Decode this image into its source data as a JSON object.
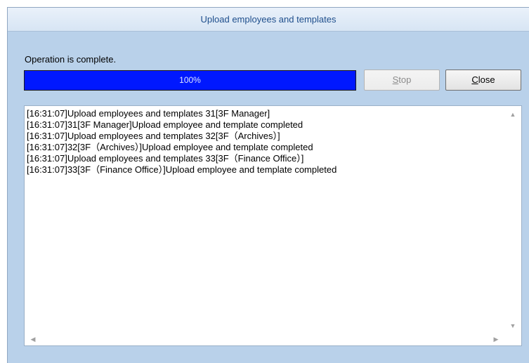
{
  "window": {
    "title": "Upload employees and templates"
  },
  "status": {
    "text": "Operation is complete."
  },
  "progress": {
    "value": 100,
    "label": "100%"
  },
  "buttons": {
    "stop_mnemonic": "S",
    "stop_rest": "top",
    "close_mnemonic": "C",
    "close_rest": "lose"
  },
  "log": {
    "lines": [
      "[16:31:07]Upload employees and templates 31[3F Manager]",
      "[16:31:07]31[3F Manager]Upload employee and template completed",
      "[16:31:07]Upload employees and templates 32[3F（Archives）]",
      "[16:31:07]32[3F（Archives）]Upload employee and template completed",
      "[16:31:07]Upload employees and templates 33[3F（Finance Office）]",
      "[16:31:07]33[3F（Finance Office）]Upload employee and template completed"
    ]
  },
  "icons": {
    "scroll_up": "triangle-up",
    "scroll_down": "triangle-down",
    "scroll_left": "triangle-left",
    "scroll_right": "triangle-right"
  },
  "colors": {
    "progress_fill": "#0018ff",
    "window_bg": "#b9d1ea",
    "title_text": "#1e4e8c"
  }
}
